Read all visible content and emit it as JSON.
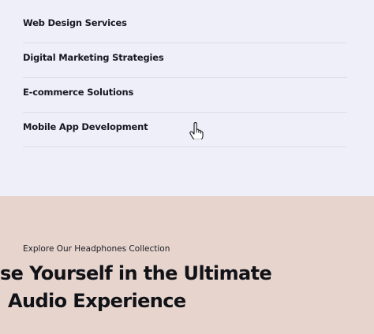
{
  "services": {
    "items": [
      {
        "label": "Web Design Services"
      },
      {
        "label": "Digital Marketing Strategies"
      },
      {
        "label": "E-commerce Solutions"
      },
      {
        "label": "Mobile App Development"
      }
    ]
  },
  "hero": {
    "eyebrow": "Explore Our Headphones Collection",
    "headline_line1": "se Yourself in the Ultimate",
    "headline_line2": "Audio Experience"
  },
  "colors": {
    "services_background": "#efeff9",
    "hero_background": "#e6d4cd",
    "text": "#161821",
    "divider": "#dcdde9"
  },
  "icons": {
    "cursor": "hand-pointer-cursor"
  }
}
